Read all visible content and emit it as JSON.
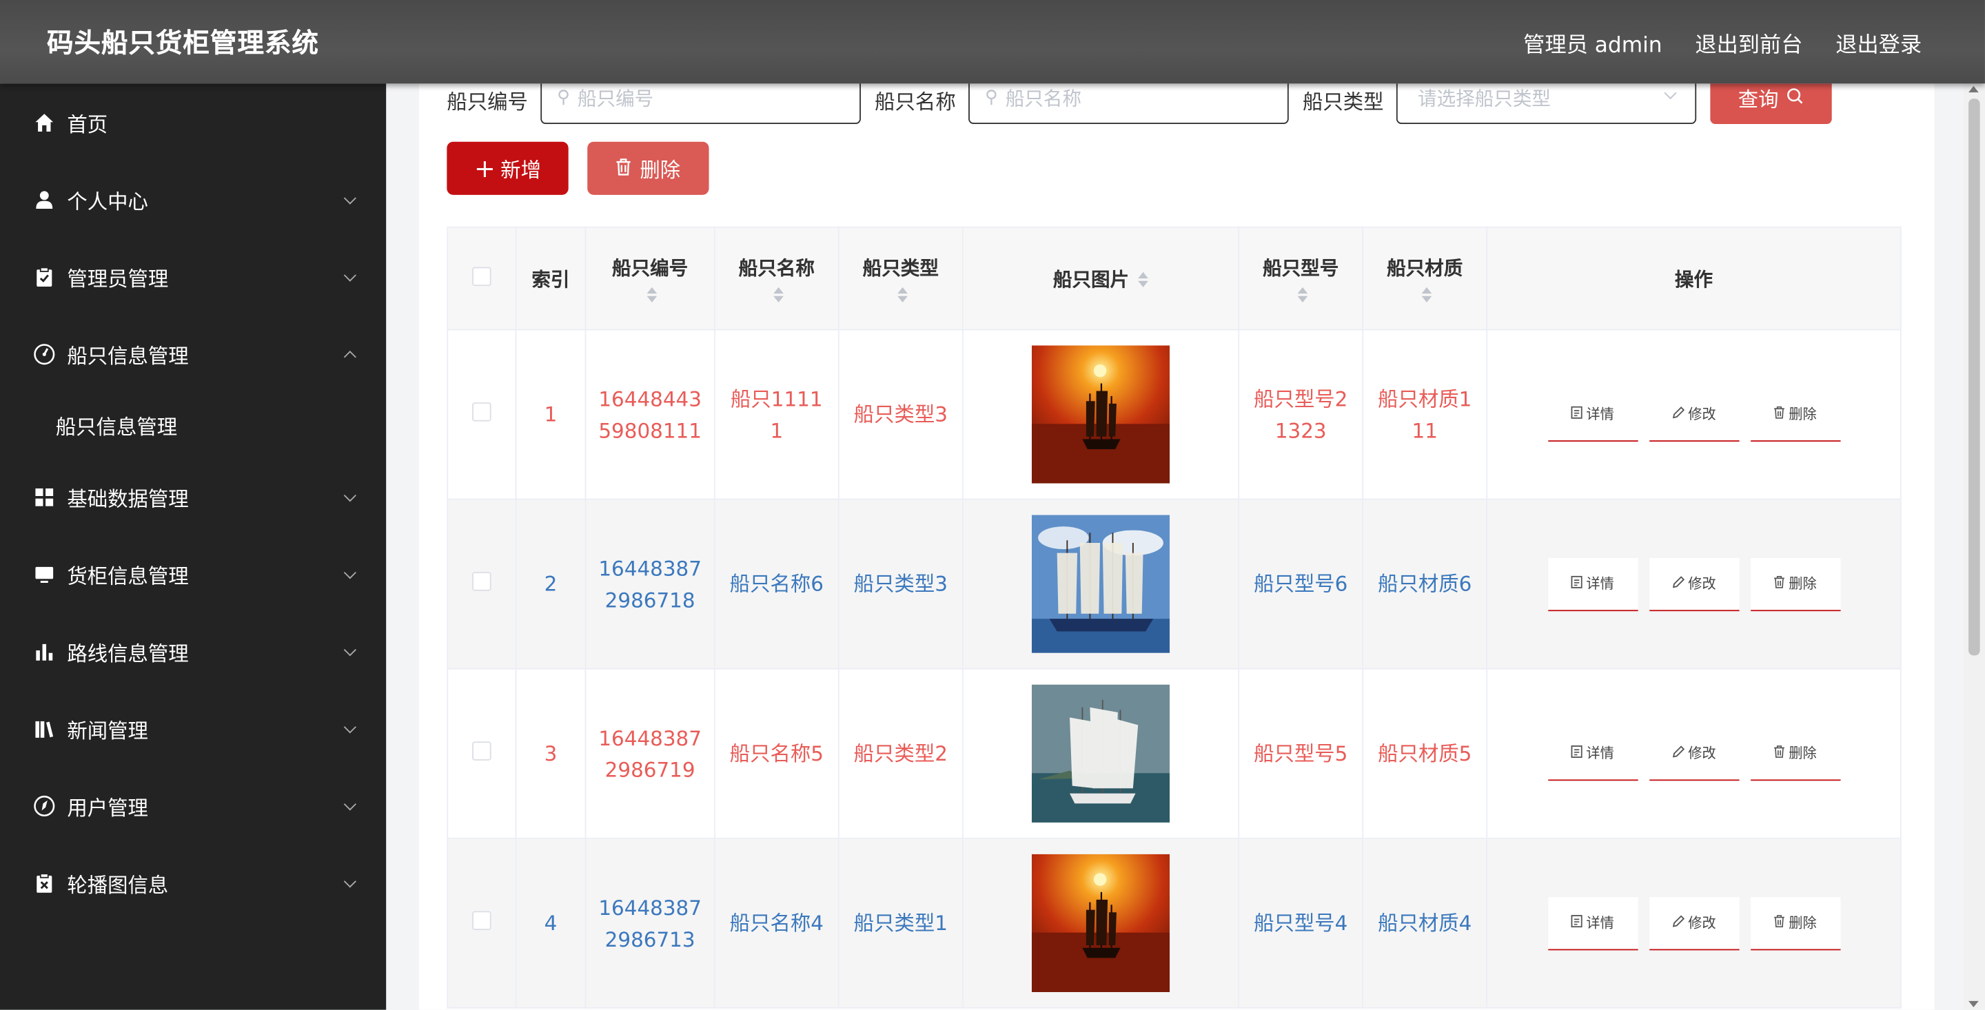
{
  "app": {
    "title": "码头船只货柜管理系统"
  },
  "header": {
    "admin_label": "管理员 admin",
    "frontend_label": "退出到前台",
    "logout_label": "退出登录"
  },
  "sidebar": {
    "items": [
      {
        "label": "首页",
        "icon": "home-icon"
      },
      {
        "label": "个人中心",
        "icon": "user-icon"
      },
      {
        "label": "管理员管理",
        "icon": "clipboard-icon"
      },
      {
        "label": "船只信息管理",
        "icon": "gauge-icon",
        "expanded": true
      },
      {
        "label": "基础数据管理",
        "icon": "grid-icon"
      },
      {
        "label": "货柜信息管理",
        "icon": "monitor-icon"
      },
      {
        "label": "路线信息管理",
        "icon": "bar-chart-icon"
      },
      {
        "label": "新闻管理",
        "icon": "books-icon"
      },
      {
        "label": "用户管理",
        "icon": "compass-icon"
      },
      {
        "label": "轮播图信息",
        "icon": "clipboard-x-icon"
      }
    ],
    "subitem": "船只信息管理"
  },
  "search": {
    "code_label": "船只编号",
    "code_placeholder": "船只编号",
    "name_label": "船只名称",
    "name_placeholder": "船只名称",
    "type_label": "船只类型",
    "type_placeholder": "请选择船只类型",
    "query_label": "查询"
  },
  "toolbar": {
    "add_label": "新增",
    "delete_label": "删除"
  },
  "table": {
    "headers": {
      "index": "索引",
      "code": "船只编号",
      "name": "船只名称",
      "type": "船只类型",
      "image": "船只图片",
      "model": "船只型号",
      "material": "船只材质",
      "ops": "操作"
    },
    "op_labels": {
      "detail": "详情",
      "edit": "修改",
      "delete": "删除"
    },
    "rows": [
      {
        "index": "1",
        "code_l1": "16448443",
        "code_l2": "59808111",
        "name_l1": "船只1111",
        "name_l2": "1",
        "type": "船只类型3",
        "model_l1": "船只型号2",
        "model_l2": "1323",
        "material_l1": "船只材质1",
        "material_l2": "11",
        "color": "red",
        "image": "sunset-ship"
      },
      {
        "index": "2",
        "code_l1": "16448387",
        "code_l2": "2986718",
        "name_l1": "船只名称6",
        "name_l2": "",
        "type": "船只类型3",
        "model_l1": "船只型号6",
        "model_l2": "",
        "material_l1": "船只材质6",
        "material_l2": "",
        "color": "blue",
        "image": "blue-sky-ship"
      },
      {
        "index": "3",
        "code_l1": "16448387",
        "code_l2": "2986719",
        "name_l1": "船只名称5",
        "name_l2": "",
        "type": "船只类型2",
        "model_l1": "船只型号5",
        "model_l2": "",
        "material_l1": "船只材质5",
        "material_l2": "",
        "color": "red",
        "image": "white-sail-ship"
      },
      {
        "index": "4",
        "code_l1": "16448387",
        "code_l2": "2986713",
        "name_l1": "船只名称4",
        "name_l2": "",
        "type": "船只类型1",
        "model_l1": "船只型号4",
        "model_l2": "",
        "material_l1": "船只材质4",
        "material_l2": "",
        "color": "blue",
        "image": "sunset-ship"
      }
    ]
  },
  "colors": {
    "accent_red": "#c40f12",
    "query_red": "#d9534f",
    "text_red": "#e85c58",
    "text_blue": "#3b78bd",
    "sidebar_bg": "#232323"
  }
}
